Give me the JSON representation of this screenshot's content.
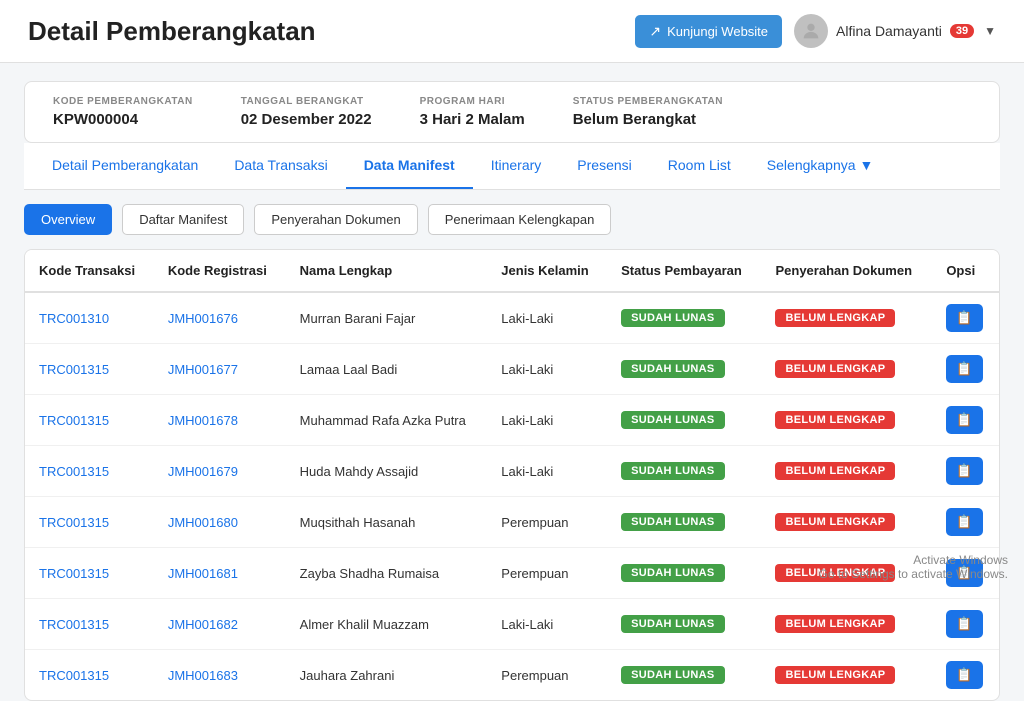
{
  "header": {
    "title": "Detail Pemberangkatan",
    "visit_btn": "Kunjungi Website",
    "user_name": "Alfina Damayanti",
    "notif_count": "39"
  },
  "info_bar": {
    "items": [
      {
        "label": "KODE PEMBERANGKATAN",
        "value": "KPW000004"
      },
      {
        "label": "TANGGAL BERANGKAT",
        "value": "02 Desember 2022"
      },
      {
        "label": "PROGRAM HARI",
        "value": "3 Hari 2 Malam"
      },
      {
        "label": "STATUS PEMBERANGKATAN",
        "value": "Belum Berangkat"
      }
    ]
  },
  "nav_tabs": [
    {
      "label": "Detail Pemberangkatan",
      "active": false
    },
    {
      "label": "Data Transaksi",
      "active": false
    },
    {
      "label": "Data Manifest",
      "active": true
    },
    {
      "label": "Itinerary",
      "active": false
    },
    {
      "label": "Presensi",
      "active": false
    },
    {
      "label": "Room List",
      "active": false
    },
    {
      "label": "Selengkapnya",
      "active": false
    }
  ],
  "sub_tabs": [
    {
      "label": "Overview",
      "active": true
    },
    {
      "label": "Daftar Manifest",
      "active": false
    },
    {
      "label": "Penyerahan Dokumen",
      "active": false
    },
    {
      "label": "Penerimaan Kelengkapan",
      "active": false
    }
  ],
  "table": {
    "columns": [
      "Kode Transaksi",
      "Kode Registrasi",
      "Nama Lengkap",
      "Jenis Kelamin",
      "Status Pembayaran",
      "Penyerahan Dokumen",
      "Opsi"
    ],
    "rows": [
      {
        "kode_transaksi": "TRC001310",
        "kode_registrasi": "JMH001676",
        "nama": "Murran Barani Fajar",
        "kelamin": "Laki-Laki",
        "status_bayar": "SUDAH LUNAS",
        "penyerahan": "BELUM LENGKAP"
      },
      {
        "kode_transaksi": "TRC001315",
        "kode_registrasi": "JMH001677",
        "nama": "Lamaa Laal Badi",
        "kelamin": "Laki-Laki",
        "status_bayar": "SUDAH LUNAS",
        "penyerahan": "BELUM LENGKAP"
      },
      {
        "kode_transaksi": "TRC001315",
        "kode_registrasi": "JMH001678",
        "nama": "Muhammad Rafa Azka Putra",
        "kelamin": "Laki-Laki",
        "status_bayar": "SUDAH LUNAS",
        "penyerahan": "BELUM LENGKAP"
      },
      {
        "kode_transaksi": "TRC001315",
        "kode_registrasi": "JMH001679",
        "nama": "Huda Mahdy Assajid",
        "kelamin": "Laki-Laki",
        "status_bayar": "SUDAH LUNAS",
        "penyerahan": "BELUM LENGKAP"
      },
      {
        "kode_transaksi": "TRC001315",
        "kode_registrasi": "JMH001680",
        "nama": "Muqsithah Hasanah",
        "kelamin": "Perempuan",
        "status_bayar": "SUDAH LUNAS",
        "penyerahan": "BELUM LENGKAP"
      },
      {
        "kode_transaksi": "TRC001315",
        "kode_registrasi": "JMH001681",
        "nama": "Zayba Shadha Rumaisa",
        "kelamin": "Perempuan",
        "status_bayar": "SUDAH LUNAS",
        "penyerahan": "BELUM LENGKAP"
      },
      {
        "kode_transaksi": "TRC001315",
        "kode_registrasi": "JMH001682",
        "nama": "Almer Khalil Muazzam",
        "kelamin": "Laki-Laki",
        "status_bayar": "SUDAH LUNAS",
        "penyerahan": "BELUM LENGKAP"
      },
      {
        "kode_transaksi": "TRC001315",
        "kode_registrasi": "JMH001683",
        "nama": "Jauhara Zahrani",
        "kelamin": "Perempuan",
        "status_bayar": "SUDAH LUNAS",
        "penyerahan": "BELUM LENGKAP"
      }
    ]
  },
  "watermark": {
    "line1": "Activate Windows",
    "line2": "Go to Settings to activate Windows."
  }
}
